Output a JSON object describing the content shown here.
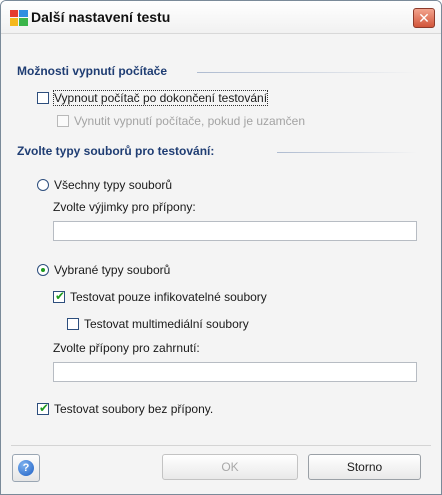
{
  "window": {
    "title": "Další nastavení testu",
    "close_glyph": "✕",
    "icon": "avg-app-icon",
    "close_color": "#d2553a"
  },
  "shutdown": {
    "heading": "Možnosti vypnutí počítače",
    "shutdown_after_scan": {
      "label": "Vypnout počítač po dokončení testování",
      "checked": false
    },
    "force_shutdown_locked": {
      "label": "Vynutit vypnutí počítače, pokud je uzamčen",
      "checked": false,
      "enabled": false
    }
  },
  "file_types": {
    "heading": "Zvolte typy souborů pro testování:",
    "all_types": {
      "label": "Všechny typy souborů",
      "selected": false
    },
    "exclusions_label": "Zvolte výjimky pro přípony:",
    "exclusions_value": "",
    "selected_types": {
      "label": "Vybrané typy souborů",
      "selected": true
    },
    "infectable_only": {
      "label": "Testovat pouze infikovatelné soubory",
      "checked": true
    },
    "multimedia": {
      "label": "Testovat multimediální soubory",
      "checked": false
    },
    "inclusions_label": "Zvolte přípony pro zahrnutí:",
    "inclusions_value": "",
    "no_extension": {
      "label": "Testovat soubory bez přípony.",
      "checked": true
    }
  },
  "footer": {
    "help_glyph": "?",
    "ok_label": "OK",
    "cancel_label": "Storno"
  },
  "colors": {
    "heading": "#1f3d73",
    "check": "#1e9a1e"
  }
}
